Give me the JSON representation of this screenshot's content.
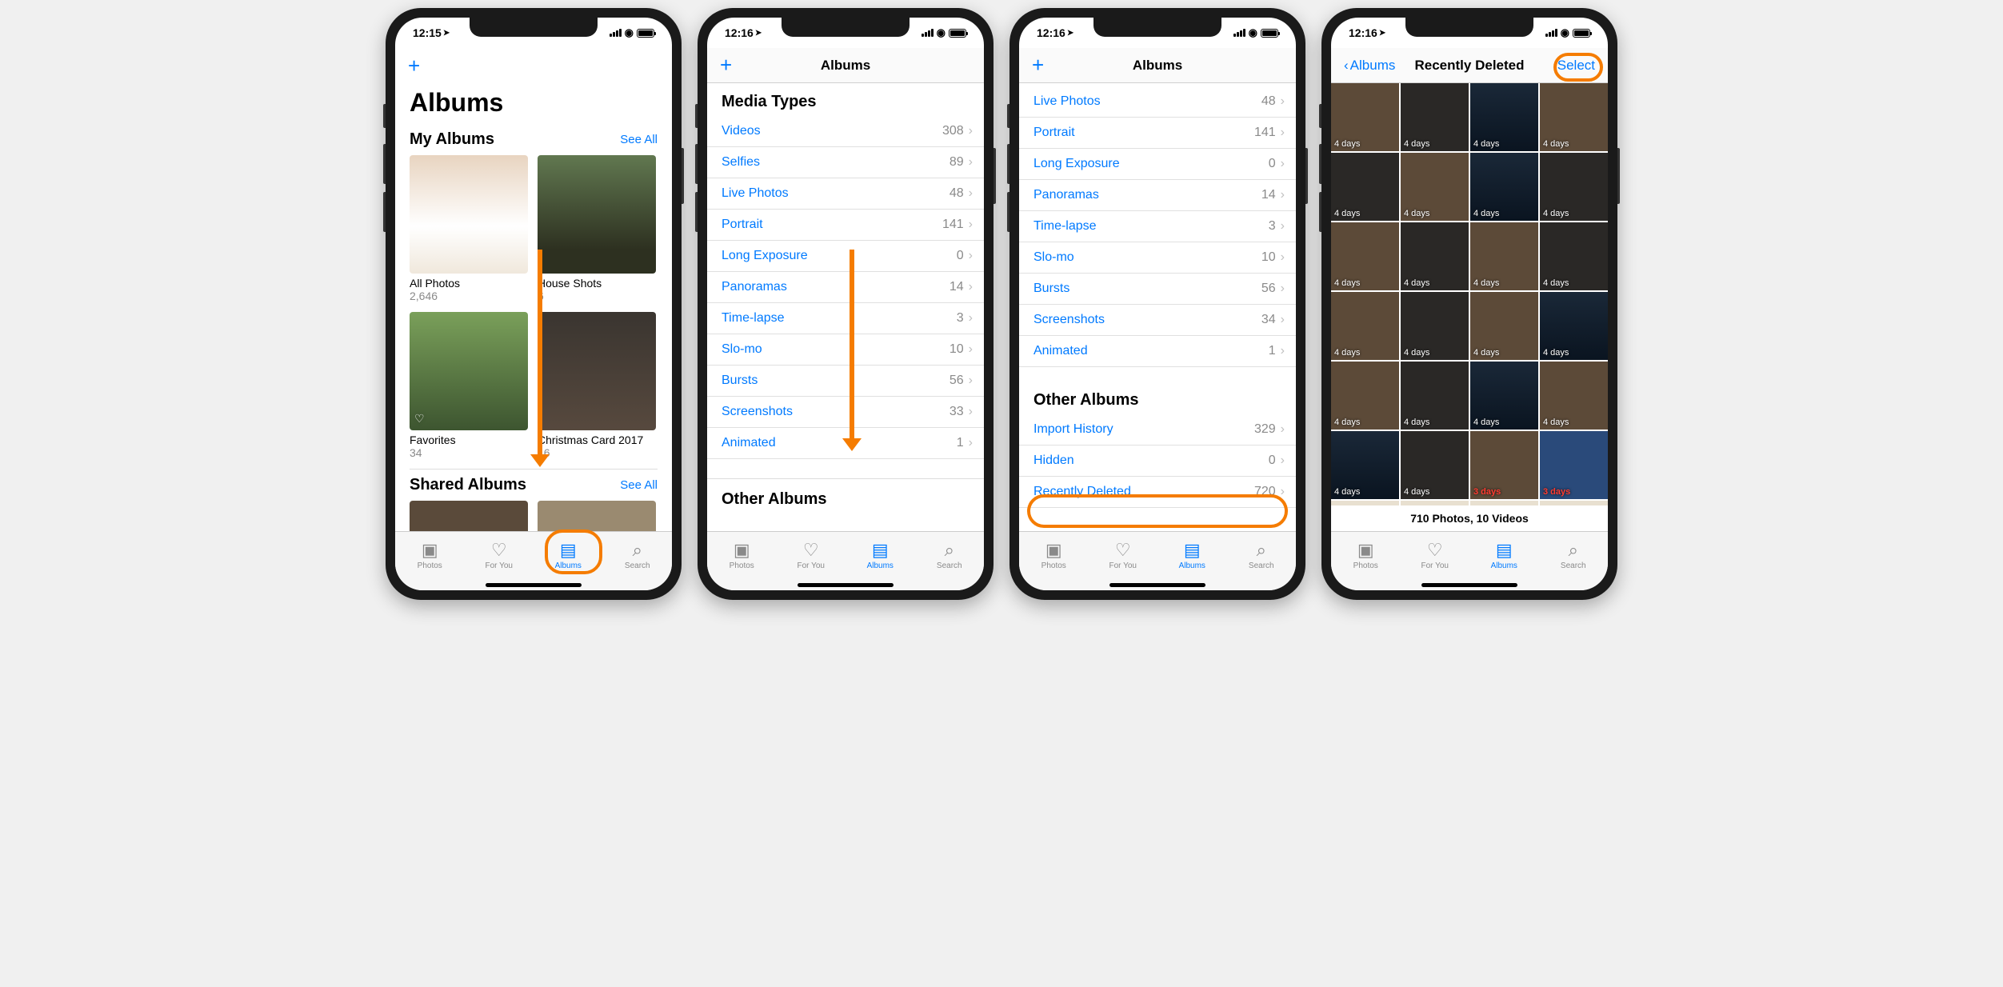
{
  "status": {
    "time1": "12:15",
    "time2": "12:16"
  },
  "screen1": {
    "add": "+",
    "title": "Albums",
    "my_albums_title": "My Albums",
    "see_all": "See All",
    "albums": [
      {
        "label": "All Photos",
        "count": "2,646"
      },
      {
        "label": "House Shots",
        "count": "6"
      },
      {
        "label": "Favorites",
        "count": "34"
      },
      {
        "label": "Christmas Card 2017",
        "count": "16"
      }
    ],
    "shared_albums_title": "Shared Albums"
  },
  "screen2": {
    "add": "+",
    "title": "Albums",
    "media_types_title": "Media Types",
    "rows": [
      {
        "label": "Videos",
        "count": "308"
      },
      {
        "label": "Selfies",
        "count": "89"
      },
      {
        "label": "Live Photos",
        "count": "48"
      },
      {
        "label": "Portrait",
        "count": "141"
      },
      {
        "label": "Long Exposure",
        "count": "0"
      },
      {
        "label": "Panoramas",
        "count": "14"
      },
      {
        "label": "Time-lapse",
        "count": "3"
      },
      {
        "label": "Slo-mo",
        "count": "10"
      },
      {
        "label": "Bursts",
        "count": "56"
      },
      {
        "label": "Screenshots",
        "count": "33"
      },
      {
        "label": "Animated",
        "count": "1"
      }
    ],
    "other_albums_title": "Other Albums"
  },
  "screen3": {
    "add": "+",
    "title": "Albums",
    "rows": [
      {
        "label": "Live Photos",
        "count": "48"
      },
      {
        "label": "Portrait",
        "count": "141"
      },
      {
        "label": "Long Exposure",
        "count": "0"
      },
      {
        "label": "Panoramas",
        "count": "14"
      },
      {
        "label": "Time-lapse",
        "count": "3"
      },
      {
        "label": "Slo-mo",
        "count": "10"
      },
      {
        "label": "Bursts",
        "count": "56"
      },
      {
        "label": "Screenshots",
        "count": "34"
      },
      {
        "label": "Animated",
        "count": "1"
      }
    ],
    "other_albums_title": "Other Albums",
    "other_rows": [
      {
        "label": "Import History",
        "count": "329"
      },
      {
        "label": "Hidden",
        "count": "0"
      },
      {
        "label": "Recently Deleted",
        "count": "720"
      }
    ]
  },
  "screen4": {
    "back": "Albums",
    "title": "Recently Deleted",
    "select": "Select",
    "footer": "710 Photos, 10 Videos",
    "tag4": "4 days",
    "tag3": "3 days"
  },
  "tabs": {
    "photos": "Photos",
    "foryou": "For You",
    "albums": "Albums",
    "search": "Search"
  }
}
